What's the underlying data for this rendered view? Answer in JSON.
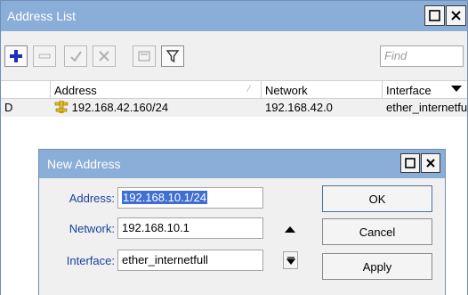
{
  "window": {
    "title": "Address List"
  },
  "toolbar": {
    "icons": [
      "plus-icon",
      "minus-icon",
      "check-icon",
      "cross-icon",
      "note-icon",
      "filter-icon"
    ],
    "find_placeholder": "Find",
    "accent_plus": "#1f2fb8"
  },
  "table": {
    "columns": [
      "",
      "Address",
      "Network",
      "Interface"
    ],
    "rows": [
      {
        "flag": "D",
        "address": "192.168.42.160/24",
        "network": "192.168.42.0",
        "interface": "ether_internetfull"
      }
    ]
  },
  "dialog": {
    "title": "New Address",
    "address_label": "Address:",
    "address_value": "192.168.10.1/24",
    "network_label": "Network:",
    "network_value": "192.168.10.1",
    "interface_label": "Interface:",
    "interface_value": "ether_internetfull",
    "ok_label": "OK",
    "cancel_label": "Cancel",
    "apply_label": "Apply"
  },
  "colors": {
    "titlebar": "#8aaed8",
    "label_blue": "#1b3f9e",
    "selection": "#3e6fd1"
  }
}
